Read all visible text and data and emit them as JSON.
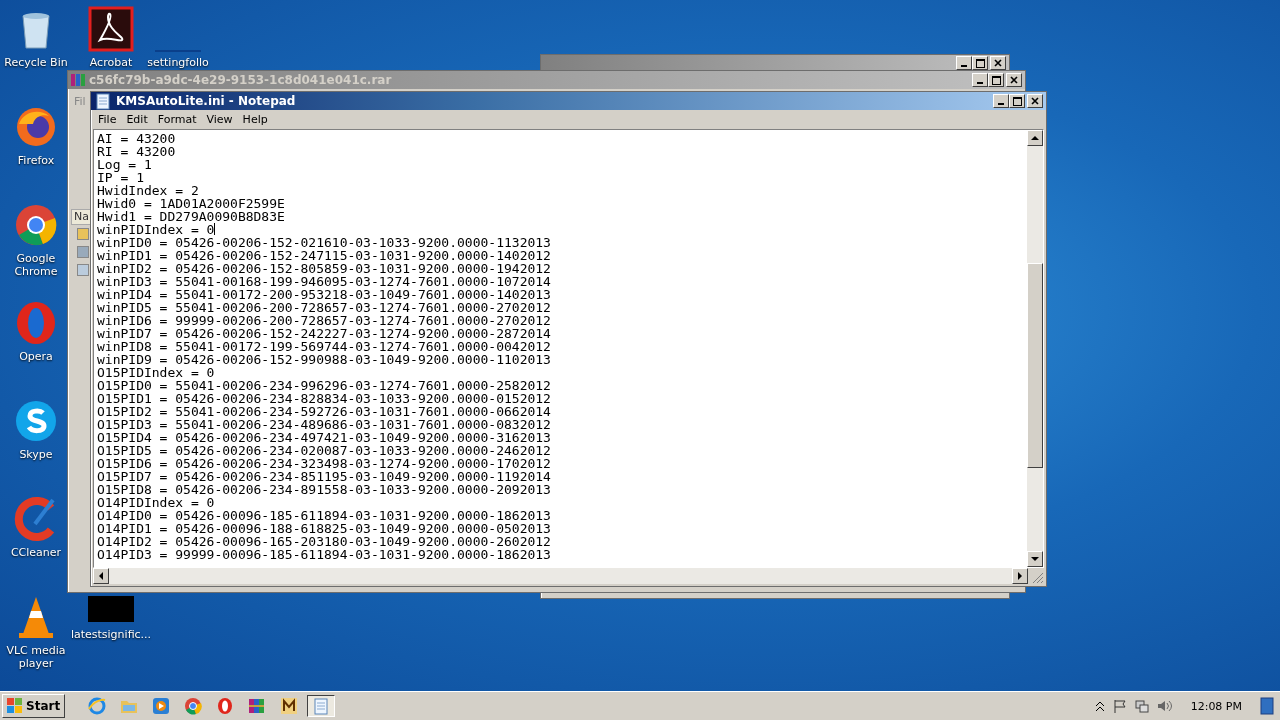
{
  "desktop_icons": [
    {
      "label": "Recycle Bin",
      "kind": "recycle"
    },
    {
      "label": "Firefox",
      "kind": "firefox"
    },
    {
      "label": "Google Chrome",
      "kind": "chrome"
    },
    {
      "label": "Opera",
      "kind": "opera"
    },
    {
      "label": "Skype",
      "kind": "skype"
    },
    {
      "label": "CCleaner",
      "kind": "ccleaner"
    },
    {
      "label": "VLC media player",
      "kind": "vlc"
    },
    {
      "label": "Acrobat",
      "kind": "acrobat"
    },
    {
      "label": "settingfollo",
      "kind": "blank"
    },
    {
      "label": "latestsignific...",
      "kind": "dark"
    }
  ],
  "archive_window": {
    "title": "c56fc79b-a9dc-4e29-9153-1c8d041e041c.rar",
    "menu": "Fil",
    "column": "Na"
  },
  "notepad": {
    "title": "KMSAutoLite.ini - Notepad",
    "menu": [
      "File",
      "Edit",
      "Format",
      "View",
      "Help"
    ],
    "lines": [
      "AI = 43200",
      "RI = 43200",
      "Log = 1",
      "IP = 1",
      "HwidIndex = 2",
      "Hwid0 = 1AD01A2000F2599E",
      "Hwid1 = DD279A0090B8D83E",
      "winPIDIndex = 0",
      "winPID0 = 05426-00206-152-021610-03-1033-9200.0000-1132013",
      "winPID1 = 05426-00206-152-247115-03-1031-9200.0000-1402012",
      "winPID2 = 05426-00206-152-805859-03-1031-9200.0000-1942012",
      "winPID3 = 55041-00168-199-946095-03-1274-7601.0000-1072014",
      "winPID4 = 55041-00172-200-953218-03-1049-7601.0000-1402013",
      "winPID5 = 55041-00206-200-728657-03-1274-7601.0000-2702012",
      "winPID6 = 99999-00206-200-728657-03-1274-7601.0000-2702012",
      "winPID7 = 05426-00206-152-242227-03-1274-9200.0000-2872014",
      "winPID8 = 55041-00172-199-569744-03-1274-7601.0000-0042012",
      "winPID9 = 05426-00206-152-990988-03-1049-9200.0000-1102013",
      "O15PIDIndex = 0",
      "O15PID0 = 55041-00206-234-996296-03-1274-7601.0000-2582012",
      "O15PID1 = 05426-00206-234-828834-03-1033-9200.0000-0152012",
      "O15PID2 = 55041-00206-234-592726-03-1031-7601.0000-0662014",
      "O15PID3 = 55041-00206-234-489686-03-1031-7601.0000-0832012",
      "O15PID4 = 05426-00206-234-497421-03-1049-9200.0000-3162013",
      "O15PID5 = 05426-00206-234-020087-03-1033-9200.0000-2462012",
      "O15PID6 = 05426-00206-234-323498-03-1274-9200.0000-1702012",
      "O15PID7 = 05426-00206-234-851195-03-1049-9200.0000-1192014",
      "O15PID8 = 05426-00206-234-891558-03-1033-9200.0000-2092013",
      "O14PIDIndex = 0",
      "O14PID0 = 05426-00096-185-611894-03-1031-9200.0000-1862013",
      "O14PID1 = 05426-00096-188-618825-03-1049-9200.0000-0502013",
      "O14PID2 = 05426-00096-165-203180-03-1049-9200.0000-2602012",
      "O14PID3 = 99999-00096-185-611894-03-1031-9200.0000-1862013"
    ]
  },
  "taskbar": {
    "start": "Start",
    "items": [
      {
        "kind": "ie",
        "selected": false
      },
      {
        "kind": "folder",
        "selected": false
      },
      {
        "kind": "media",
        "selected": false
      },
      {
        "kind": "chrome",
        "selected": false
      },
      {
        "kind": "opera",
        "selected": false
      },
      {
        "kind": "winrar",
        "selected": false
      },
      {
        "kind": "kms",
        "selected": false
      },
      {
        "kind": "notepad",
        "selected": true
      }
    ],
    "clock": "12:08 PM"
  }
}
